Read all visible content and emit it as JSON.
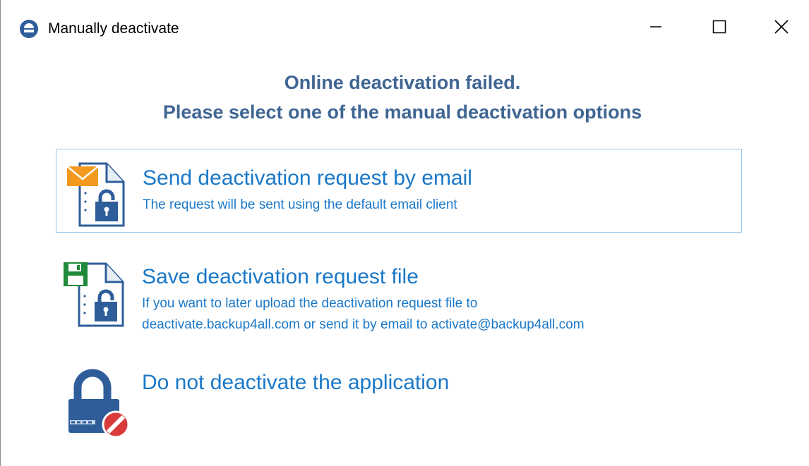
{
  "window": {
    "title": "Manually deactivate",
    "icons": {
      "app": "app-logo-icon",
      "minimize": "minimize-icon",
      "maximize": "maximize-icon",
      "close": "close-icon"
    }
  },
  "heading": {
    "line1": "Online deactivation failed.",
    "line2": "Please select one of the manual deactivation options"
  },
  "options": [
    {
      "title": "Send deactivation request by email",
      "description": "The request will be sent using the default email client",
      "icon": "email-lock-document-icon",
      "selected": true
    },
    {
      "title": "Save deactivation request file",
      "description_line1": "If you want to later upload the deactivation request file to",
      "description_line2": "deactivate.backup4all.com or send it by email to activate@backup4all.com",
      "icon": "save-lock-document-icon",
      "selected": false
    },
    {
      "title": "Do not deactivate the application",
      "icon": "lock-forbidden-icon",
      "selected": false
    }
  ],
  "colors": {
    "heading": "#3f6593",
    "link": "#1a78c8",
    "selection_border": "#99c7ee",
    "icon_blue": "#2e5d9a",
    "envelope_orange": "#f39a1e",
    "disk_green": "#1f8a3a",
    "forbidden_red": "#d93a3a"
  }
}
